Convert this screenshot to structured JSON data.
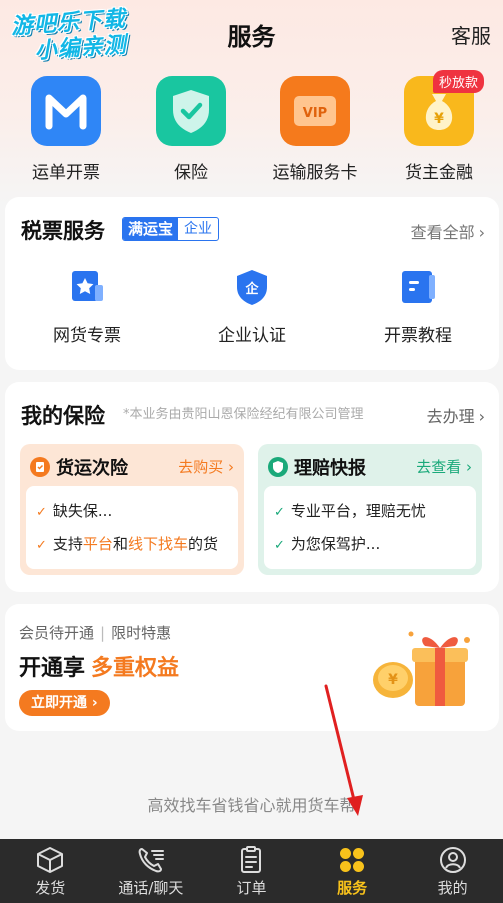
{
  "watermark": {
    "line1": "游吧乐下载",
    "line2": "小编亲测"
  },
  "header": {
    "title": "服务",
    "right_action": "客服"
  },
  "tiles": [
    {
      "label": "运单开票",
      "icon": "m-logo-icon",
      "color": "#2f86f6"
    },
    {
      "label": "保险",
      "icon": "shield-check-icon",
      "color": "#19c6a0"
    },
    {
      "label": "运输服务卡",
      "icon": "vip-card-icon",
      "color": "#f57a1c"
    },
    {
      "label": "货主金融",
      "icon": "money-bag-icon",
      "color": "#f9b81c",
      "badge": "秒放款"
    }
  ],
  "tax_service": {
    "title": "税票服务",
    "brand_tag_main": "满运宝",
    "brand_tag_sub": "企业",
    "see_all": "查看全部",
    "items": [
      {
        "label": "网货专票",
        "icon": "star-doc-icon"
      },
      {
        "label": "企业认证",
        "icon": "enterprise-shield-icon"
      },
      {
        "label": "开票教程",
        "icon": "book-icon"
      }
    ]
  },
  "insurance": {
    "title": "我的保险",
    "note": "*本业务由贵阳山恩保险经纪有限公司管理",
    "action": "去办理",
    "freight": {
      "title": "货运次险",
      "link": "去购买",
      "line1": "缺失保...",
      "line2_a": "支持",
      "line2_b": "平台",
      "line2_c": "和",
      "line2_d": "线下找车",
      "line2_e": "的货"
    },
    "claims": {
      "title": "理赔快报",
      "link": "去查看",
      "line1": "专业平台，理赔无忧",
      "line2": "为您保驾护..."
    }
  },
  "membership": {
    "status": "会员待开通",
    "promo": "限时特惠",
    "headline_a": "开通享",
    "headline_b": "多重权益",
    "button": "立即开通"
  },
  "slogan": "高效找车省钱省心就用货车帮",
  "tabbar": [
    {
      "label": "发货",
      "icon": "box-icon",
      "active": false
    },
    {
      "label": "通话/聊天",
      "icon": "phone-chat-icon",
      "active": false
    },
    {
      "label": "订单",
      "icon": "order-list-icon",
      "active": false
    },
    {
      "label": "服务",
      "icon": "clover-icon",
      "active": true
    },
    {
      "label": "我的",
      "icon": "user-icon",
      "active": false
    }
  ],
  "colors": {
    "accent": "#f47a20",
    "brand_blue": "#2a74ef",
    "tab_active": "#f8c21b"
  }
}
